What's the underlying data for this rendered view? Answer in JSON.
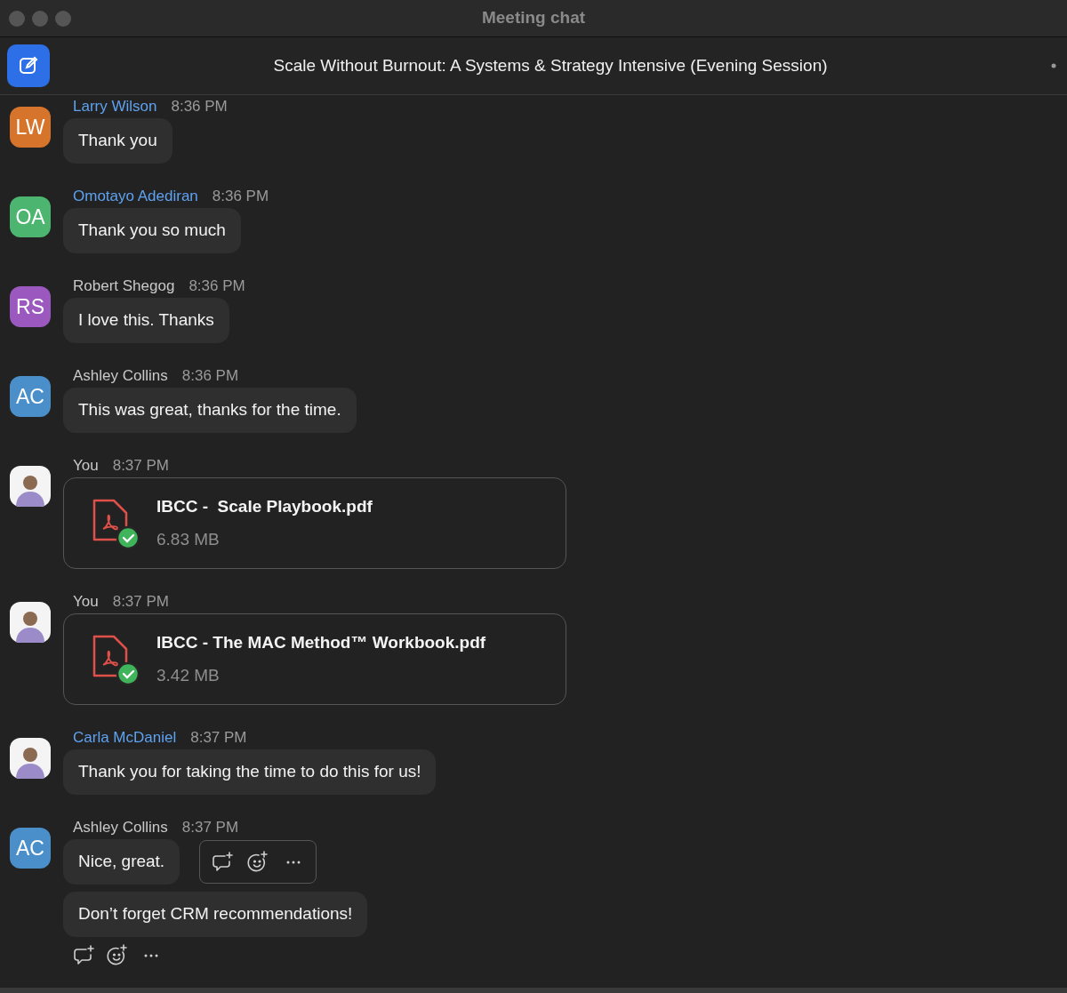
{
  "window": {
    "title": "Meeting chat"
  },
  "header": {
    "title": "Scale Without Burnout: A Systems & Strategy Intensive (Evening Session)"
  },
  "messages": [
    {
      "author": "Larry Wilson",
      "highlighted": true,
      "time": "8:36 PM",
      "avatar": {
        "kind": "initials",
        "initials": "LW",
        "color": "#d7742c"
      },
      "footer_actions": false,
      "bubbles": [
        {
          "kind": "text",
          "text": "Thank you",
          "show_actions": false
        }
      ]
    },
    {
      "author": "Omotayo Adediran",
      "highlighted": true,
      "time": "8:36 PM",
      "avatar": {
        "kind": "initials",
        "initials": "OA",
        "color": "#4cb56f"
      },
      "footer_actions": false,
      "bubbles": [
        {
          "kind": "text",
          "text": "Thank you so much",
          "show_actions": false
        }
      ]
    },
    {
      "author": "Robert Shegog",
      "highlighted": false,
      "time": "8:36 PM",
      "avatar": {
        "kind": "initials",
        "initials": "RS",
        "color": "#9b59c0"
      },
      "footer_actions": false,
      "bubbles": [
        {
          "kind": "text",
          "text": "I love this. Thanks",
          "show_actions": false
        }
      ]
    },
    {
      "author": "Ashley Collins",
      "highlighted": false,
      "time": "8:36 PM",
      "avatar": {
        "kind": "initials",
        "initials": "AC",
        "color": "#4a8fc9"
      },
      "footer_actions": false,
      "bubbles": [
        {
          "kind": "text",
          "text": "This was great, thanks for the time.",
          "show_actions": false
        }
      ]
    },
    {
      "author": "You",
      "highlighted": false,
      "time": "8:37 PM",
      "avatar": {
        "kind": "photo"
      },
      "footer_actions": false,
      "bubbles": [
        {
          "kind": "file",
          "filename": "IBCC -  Scale Playbook.pdf",
          "size": "6.83 MB",
          "show_actions": false
        }
      ]
    },
    {
      "author": "You",
      "highlighted": false,
      "time": "8:37 PM",
      "avatar": {
        "kind": "photo"
      },
      "footer_actions": false,
      "bubbles": [
        {
          "kind": "file",
          "filename": "IBCC - The MAC Method™ Workbook.pdf",
          "size": "3.42 MB",
          "show_actions": false
        }
      ]
    },
    {
      "author": "Carla McDaniel",
      "highlighted": true,
      "time": "8:37 PM",
      "avatar": {
        "kind": "photo"
      },
      "footer_actions": false,
      "bubbles": [
        {
          "kind": "text",
          "text": "Thank you for taking the time to do this for us!",
          "show_actions": false
        }
      ]
    },
    {
      "author": "Ashley Collins",
      "highlighted": false,
      "time": "8:37 PM",
      "avatar": {
        "kind": "initials",
        "initials": "AC",
        "color": "#4a8fc9"
      },
      "footer_actions": true,
      "bubbles": [
        {
          "kind": "text",
          "text": "Nice, great.",
          "show_actions": true
        },
        {
          "kind": "text",
          "text": "Don’t forget CRM recommendations!",
          "show_actions": false
        }
      ]
    }
  ]
}
